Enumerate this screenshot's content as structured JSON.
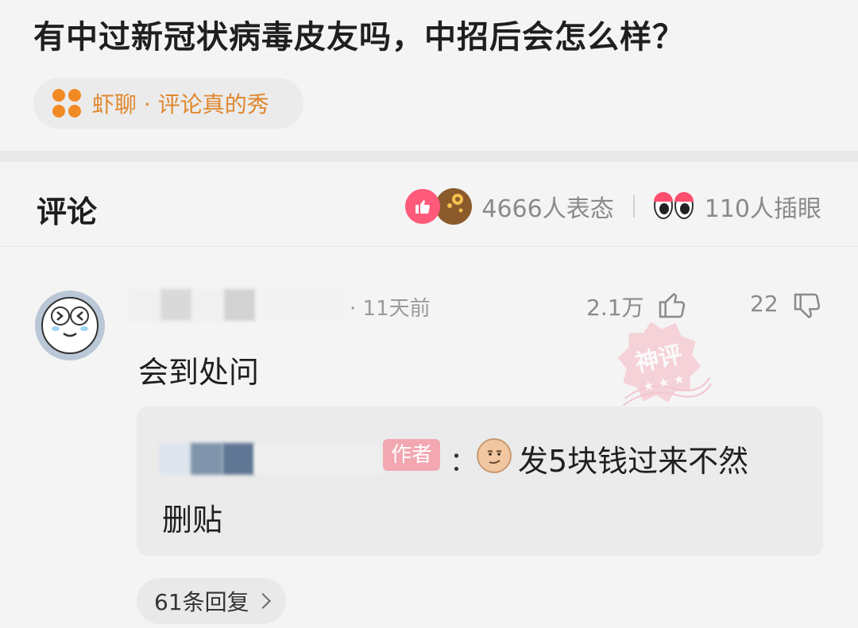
{
  "post": {
    "title": "有中过新冠状病毒皮友吗，中招后会怎么样？",
    "topic": "虾聊 · 评论真的秀"
  },
  "comments_header": {
    "title": "评论",
    "reactions_text": "4666人表态",
    "eyes_text": "110人插眼"
  },
  "comment": {
    "time": "· 11天前",
    "like_count": "2.1万",
    "dislike_count": "22",
    "text": "会到处问",
    "stamp_label": "神评",
    "reply": {
      "author_badge": "作者",
      "colon": "：",
      "line1": "发5块钱过来不然",
      "line2": "删贴"
    },
    "replies_label": "61条回复"
  },
  "colors": {
    "topic_accent": "#e0872d",
    "like_pink": "#ff5a7a",
    "author_badge": "#f2a7b1"
  }
}
